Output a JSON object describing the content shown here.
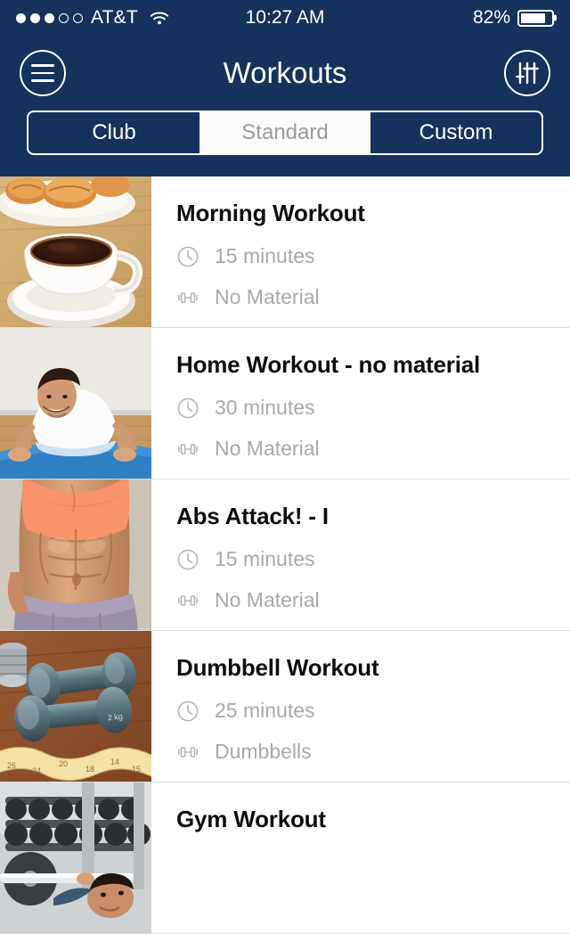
{
  "status_bar": {
    "carrier": "AT&T",
    "signal_dots_total": 5,
    "signal_dots_filled": 3,
    "wifi_icon": "wifi-icon",
    "time": "10:27 AM",
    "battery_percent": "82%",
    "battery_level": 82
  },
  "nav": {
    "menu_icon": "hamburger-menu-icon",
    "title": "Workouts",
    "filter_icon": "sliders-filter-icon"
  },
  "segmented_control": {
    "options": [
      {
        "label": "Club",
        "selected": false
      },
      {
        "label": "Standard",
        "selected": true
      },
      {
        "label": "Custom",
        "selected": false
      }
    ]
  },
  "colors": {
    "navy": "#16325C",
    "active_segment_bg": "#FBFBFB",
    "active_segment_text": "#9B9B9B",
    "title_text": "#0D0D0D",
    "meta_text": "#A9A9A9",
    "divider": "#DEDEDE"
  },
  "workouts": [
    {
      "title": "Morning Workout",
      "duration": "15 minutes",
      "material": "No Material",
      "duration_icon": "clock-icon",
      "material_icon": "dumbbell-icon",
      "thumbnail": "coffee-cup-and-croissants-photo"
    },
    {
      "title": "Home Workout - no material",
      "duration": "30 minutes",
      "material": "No Material",
      "duration_icon": "clock-icon",
      "material_icon": "dumbbell-icon",
      "thumbnail": "man-doing-pushups-on-mat-photo"
    },
    {
      "title": "Abs Attack! - I",
      "duration": "15 minutes",
      "material": "No Material",
      "duration_icon": "clock-icon",
      "material_icon": "dumbbell-icon",
      "thumbnail": "woman-abs-closeup-photo"
    },
    {
      "title": "Dumbbell Workout",
      "duration": "25 minutes",
      "material": "Dumbbells",
      "duration_icon": "clock-icon",
      "material_icon": "dumbbell-icon",
      "thumbnail": "teal-dumbbells-and-tape-measure-photo"
    },
    {
      "title": "Gym Workout",
      "duration": "",
      "material": "",
      "duration_icon": "clock-icon",
      "material_icon": "dumbbell-icon",
      "thumbnail": "man-bench-pressing-in-gym-photo"
    }
  ]
}
